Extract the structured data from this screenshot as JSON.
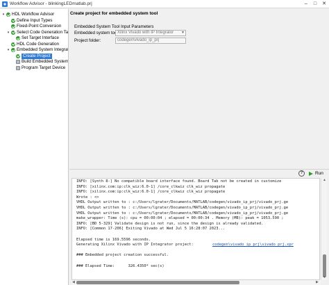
{
  "window": {
    "title": "Workflow Advisor - blinkingLEDmatlab.prj"
  },
  "tree": {
    "items": [
      {
        "label": "HDL Workflow Advisor",
        "status": "ok",
        "level": 0,
        "twisty": "▾"
      },
      {
        "label": "Define Input Types",
        "status": "ok",
        "level": 1,
        "twisty": ""
      },
      {
        "label": "Fixed-Point Conversion",
        "status": "ok",
        "level": 1,
        "twisty": ""
      },
      {
        "label": "Select Code Generation Target",
        "status": "ok",
        "level": 1,
        "twisty": "▾"
      },
      {
        "label": "Set Target Interface",
        "status": "ok",
        "level": 2,
        "twisty": ""
      },
      {
        "label": "HDL Code Generation",
        "status": "ok",
        "level": 1,
        "twisty": ""
      },
      {
        "label": "Embedded System Integration",
        "status": "ok",
        "level": 1,
        "twisty": "▾"
      },
      {
        "label": "Create Project",
        "status": "ok",
        "level": 2,
        "twisty": "",
        "selected": true
      },
      {
        "label": "Build Embedded System",
        "status": "task",
        "level": 2,
        "twisty": ""
      },
      {
        "label": "Program Target Device",
        "status": "task",
        "level": 2,
        "twisty": ""
      }
    ]
  },
  "panel": {
    "title": "Create project for embedded system tool",
    "group_title": "Embedded System Tool Input Parameters",
    "tool_label": "Embedded system tool:",
    "tool_value": "Xilinx Vivado with IP Integrator",
    "folder_label": "Project folder:",
    "folder_value": "codegen\\vivado_ip_prj"
  },
  "toolbar": {
    "help_label": "?",
    "run_label": "Run"
  },
  "log": {
    "lines": [
      "INFO: [Synth 8-] No compatible board interface found. Board Tab not be created in customize",
      "INFO: [xilinx.com:ip:clk_wiz:6.0-1] /core_clkwiz clk_wiz propagate",
      "INFO: [xilinx.com:ip:clk_wiz:6.0-1] /core_clkwiz clk_wiz propagate",
      "Wrote : <>",
      "VHDL Output written to : c:/Users/lgrater/Documents/MATLAB/codegen/vivado_ip_prj/vivado_prj.ge",
      "VHDL Output written to : c:/Users/lgrater/Documents/MATLAB/codegen/vivado_ip_prj/vivado_prj.ge",
      "VHDL Output written to : c:/Users/lgrater/Documents/MATLAB/codegen/vivado_ip_prj/vivado_prj.ge",
      "make_wrapper: Time (s): cpu = 00:00:04 ; elapsed = 00:00:34 . Memory (MB): peak = 1053.590 ;",
      "INFO: [BD 5-329] Validate design is not run, since the design is already validated.",
      "INFO: [Common 17-206] Exiting Vivado at Wed Jul 5 16:28:07 2023...",
      "",
      "Elapsed time is 169.5596 seconds.",
      "Generating Xilinx Vivado with IP Integrator project: ",
      "",
      "### Embedded project creation successful.",
      "",
      "### Elapsed Time:      326.4350* sec(s)"
    ],
    "link_text": "codegen\\vivado_ip_prj\\vivado_prj.xpr"
  },
  "colors": {
    "accent": "#2f7bd8",
    "success": "#2e9a2e",
    "link": "#1a4fb5"
  }
}
